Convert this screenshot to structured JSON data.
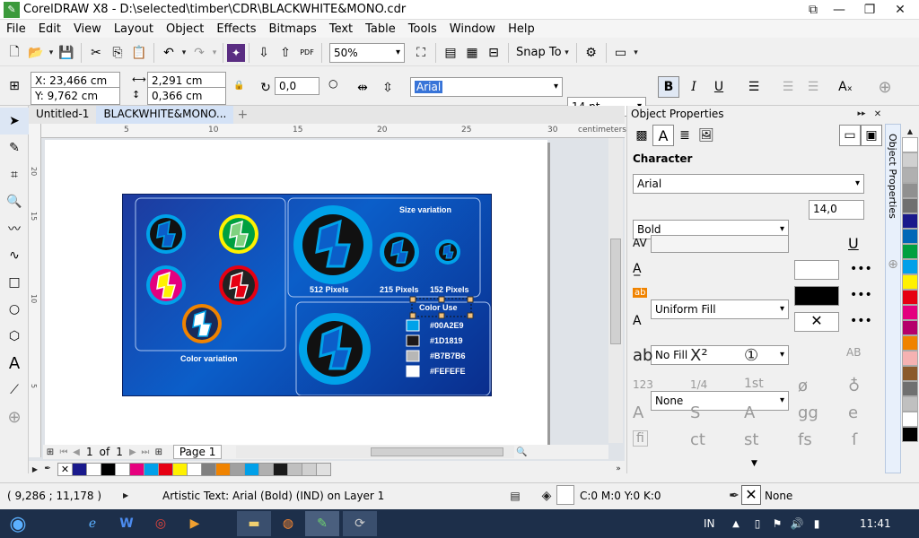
{
  "title": {
    "app_title": "CorelDRAW X8 - D:\\selected\\timber\\CDR\\BLACKWHITE&MONO.cdr"
  },
  "menu": [
    "File",
    "Edit",
    "View",
    "Layout",
    "Object",
    "Effects",
    "Bitmaps",
    "Text",
    "Table",
    "Tools",
    "Window",
    "Help"
  ],
  "std": {
    "zoom": "50%",
    "snap": "Snap To",
    "pdf": "PDF"
  },
  "prop": {
    "x": "X: 23,466 cm",
    "y": "Y: 9,762 cm",
    "w": "2,291 cm",
    "h": "0,366 cm",
    "angle": "0,0",
    "font": "Arial",
    "size": "14 pt"
  },
  "doctabs": [
    "Untitled-1",
    "BLACKWHITE&MONO..."
  ],
  "ruler": {
    "top": [
      "5",
      "10",
      "15",
      "20",
      "25",
      "30"
    ],
    "unit": "centimeters",
    "left": [
      "20",
      "15",
      "10",
      "5"
    ]
  },
  "art": {
    "color_variation": "Color variation",
    "size_variation": "Size variation",
    "px512": "512 Pixels",
    "px215": "215 Pixels",
    "px152": "152 Pixels",
    "color_use": "Color Use",
    "swatches": [
      "#00A2E9",
      "#1D1819",
      "#B7B7B6",
      "#FEFEFE"
    ]
  },
  "pagenav": {
    "current": "1",
    "of": "of",
    "total": "1",
    "page_tab": "Page 1"
  },
  "panel": {
    "title": "Object Properties",
    "character": "Character",
    "font": "Arial",
    "weight": "Bold",
    "size": "14,0",
    "fill1": "Uniform Fill",
    "fill2": "No Fill",
    "outline": "None",
    "side_tab": "Object Properties"
  },
  "status": {
    "coords": "( 9,286 ; 11,178 )",
    "info": "Artistic Text: Arial (Bold) (IND) on Layer 1",
    "cmyk": "C:0 M:0 Y:0 K:0",
    "outline": "None"
  },
  "taskbar": {
    "lang": "IN",
    "time": "11:41"
  },
  "colors": {
    "palette_strip": [
      "#ffffff",
      "#1a1a8c",
      "#ffffff",
      "#000000",
      "#ffffff",
      "#e6007e",
      "#00a0e9",
      "#e60012",
      "#fff100",
      "#ffffff",
      "#808080",
      "#f08300",
      "#a0a0a0",
      "#00a0e9",
      "#b0b0b0",
      "#1a1a1a",
      "#c0c0c0",
      "#d0d0d0",
      "#e0e0e0"
    ],
    "palette_right": [
      "#ffffff",
      "#d0d0d0",
      "#b0b0b0",
      "#909090",
      "#707070",
      "#1a1a8c",
      "#0068b7",
      "#00a040",
      "#00a0e9",
      "#fff100",
      "#e60012",
      "#e4007f",
      "#b5006b",
      "#f08300",
      "#f5b2b2",
      "#8b5a2b",
      "#707070",
      "#c0c0c0",
      "#ffffff",
      "#000000"
    ]
  }
}
